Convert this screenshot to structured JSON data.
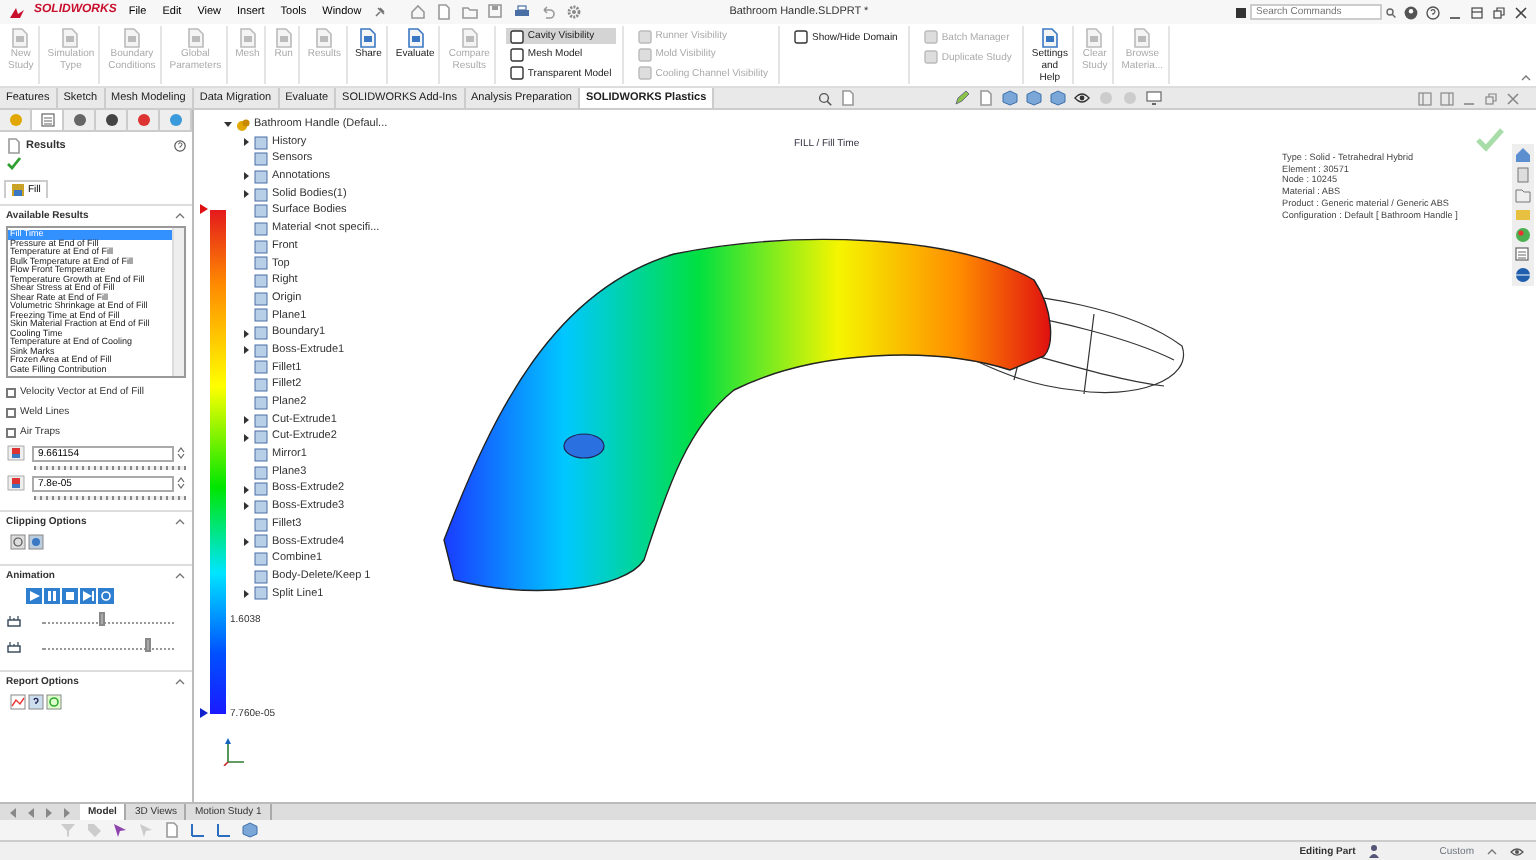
{
  "title_bar": {
    "logo": "SOLIDWORKS",
    "menus": [
      "File",
      "Edit",
      "View",
      "Insert",
      "Tools",
      "Window"
    ],
    "document_title": "Bathroom Handle.SLDPRT *",
    "search": {
      "placeholder": "Search Commands"
    }
  },
  "ribbon": [
    {
      "kind": "large",
      "label": "New Study",
      "disabled": true
    },
    {
      "kind": "large",
      "label": "Simulation Type",
      "disabled": true
    },
    {
      "kind": "large",
      "label": "Boundary Conditions",
      "disabled": true
    },
    {
      "kind": "large",
      "label": "Global Parameters",
      "disabled": true
    },
    {
      "kind": "large",
      "label": "Mesh",
      "disabled": true
    },
    {
      "kind": "large",
      "label": "Run",
      "disabled": true
    },
    {
      "kind": "large",
      "label": "Results",
      "disabled": true
    },
    {
      "kind": "large",
      "label": "Share",
      "disabled": false
    },
    {
      "kind": "large",
      "label": "Evaluate",
      "disabled": false
    },
    {
      "kind": "large",
      "label": "Compare Results",
      "disabled": true
    },
    {
      "kind": "stack",
      "buttons": [
        {
          "label": "Cavity Visibility",
          "disabled": false,
          "selected": true
        },
        {
          "label": "Mesh Model",
          "disabled": false,
          "selected": false
        },
        {
          "label": "Transparent Model",
          "disabled": false,
          "selected": false
        }
      ]
    },
    {
      "kind": "stack",
      "buttons": [
        {
          "label": "Runner Visibility",
          "disabled": true,
          "selected": false
        },
        {
          "label": "Mold Visibility",
          "disabled": true,
          "selected": false
        },
        {
          "label": "Cooling Channel Visibility",
          "disabled": true,
          "selected": false
        }
      ]
    },
    {
      "kind": "stack",
      "buttons": [
        {
          "label": "Show/Hide Domain",
          "disabled": false,
          "selected": false
        }
      ]
    },
    {
      "kind": "stack",
      "buttons": [
        {
          "label": "Batch Manager",
          "disabled": true,
          "selected": false
        },
        {
          "label": "Duplicate Study",
          "disabled": true,
          "selected": false
        }
      ]
    },
    {
      "kind": "large",
      "label": "Settings and Help",
      "disabled": false
    },
    {
      "kind": "large",
      "label": "Clear Study",
      "disabled": true
    },
    {
      "kind": "large",
      "label": "Browse Materia...",
      "disabled": true
    }
  ],
  "command_tabs": [
    {
      "label": "Features",
      "selected": false
    },
    {
      "label": "Sketch",
      "selected": false
    },
    {
      "label": "Mesh Modeling",
      "selected": false
    },
    {
      "label": "Data Migration",
      "selected": false
    },
    {
      "label": "Evaluate",
      "selected": false
    },
    {
      "label": "SOLIDWORKS Add-Ins",
      "selected": false
    },
    {
      "label": "Analysis Preparation",
      "selected": false
    },
    {
      "label": "SOLIDWORKS Plastics",
      "selected": true
    }
  ],
  "property_manager": {
    "tabs": [
      {
        "selected": false
      },
      {
        "selected": true
      },
      {
        "selected": false
      },
      {
        "selected": false
      },
      {
        "selected": false
      },
      {
        "selected": false
      }
    ],
    "title": "Results",
    "result_tabs": [
      {
        "label": "Fill",
        "selected": true
      }
    ],
    "available_results": {
      "title": "Available Results",
      "items": [
        {
          "label": "Fill Time",
          "selected": true
        },
        {
          "label": "Pressure at End of Fill",
          "selected": false
        },
        {
          "label": "Temperature at End of Fill",
          "selected": false
        },
        {
          "label": "Bulk Temperature at End of Fill",
          "selected": false
        },
        {
          "label": "Flow Front Temperature",
          "selected": false
        },
        {
          "label": "Temperature Growth at End of Fill",
          "selected": false
        },
        {
          "label": "Shear Stress at End of Fill",
          "selected": false
        },
        {
          "label": "Shear Rate at End of Fill",
          "selected": false
        },
        {
          "label": "Volumetric Shrinkage at End of Fill",
          "selected": false
        },
        {
          "label": "Freezing Time at End of Fill",
          "selected": false
        },
        {
          "label": "Skin Material Fraction at End of Fill",
          "selected": false
        },
        {
          "label": "Cooling Time",
          "selected": false
        },
        {
          "label": "Temperature at End of Cooling",
          "selected": false
        },
        {
          "label": "Sink Marks",
          "selected": false
        },
        {
          "label": "Frozen Area at End of Fill",
          "selected": false
        },
        {
          "label": "Gate Filling Contribution",
          "selected": false
        }
      ]
    },
    "options": [
      {
        "label": "Velocity Vector at End of Fill",
        "checked": false
      },
      {
        "label": "Weld Lines",
        "checked": false
      },
      {
        "label": "Air Traps",
        "checked": false
      }
    ],
    "fields": [
      {
        "value": "9.661154"
      },
      {
        "value": "7.8e-05"
      }
    ],
    "clipping": {
      "title": "Clipping Options"
    },
    "animation": {
      "title": "Animation",
      "sliders": [
        {
          "level": 0.45
        },
        {
          "level": 0.8
        }
      ]
    },
    "report": {
      "title": "Report Options"
    }
  },
  "feature_tree": {
    "root": {
      "label": "Bathroom Handle (Defaul...",
      "expanded": true
    },
    "items": [
      {
        "label": "History",
        "expandable": true
      },
      {
        "label": "Sensors",
        "expandable": false
      },
      {
        "label": "Annotations",
        "expandable": true
      },
      {
        "label": "Solid Bodies(1)",
        "expandable": true
      },
      {
        "label": "Surface Bodies",
        "expandable": false
      },
      {
        "label": "Material <not specifi...",
        "expandable": false
      },
      {
        "label": "Front",
        "expandable": false
      },
      {
        "label": "Top",
        "expandable": false
      },
      {
        "label": "Right",
        "expandable": false
      },
      {
        "label": "Origin",
        "expandable": false
      },
      {
        "label": "Plane1",
        "expandable": false
      },
      {
        "label": "Boundary1",
        "expandable": true
      },
      {
        "label": "Boss-Extrude1",
        "expandable": true
      },
      {
        "label": "Fillet1",
        "expandable": false
      },
      {
        "label": "Fillet2",
        "expandable": false
      },
      {
        "label": "Plane2",
        "expandable": false
      },
      {
        "label": "Cut-Extrude1",
        "expandable": true
      },
      {
        "label": "Cut-Extrude2",
        "expandable": true
      },
      {
        "label": "Mirror1",
        "expandable": false
      },
      {
        "label": "Plane3",
        "expandable": false
      },
      {
        "label": "Boss-Extrude2",
        "expandable": true
      },
      {
        "label": "Boss-Extrude3",
        "expandable": true
      },
      {
        "label": "Fillet3",
        "expandable": false
      },
      {
        "label": "Boss-Extrude4",
        "expandable": true
      },
      {
        "label": "Combine1",
        "expandable": false
      },
      {
        "label": "Body-Delete/Keep 1",
        "expandable": false
      },
      {
        "label": "Split Line1",
        "expandable": true
      }
    ]
  },
  "viewport": {
    "plot_title": "FILL / Fill Time",
    "info": [
      "Type : Solid - Tetrahedral Hybrid",
      "Element : 30571",
      "Node : 10245",
      "Material : ABS",
      "Product : Generic material / Generic ABS",
      "Configuration : Default [ Bathroom Handle ]"
    ],
    "legend_labels": [
      "1.6038",
      "7.760e-05"
    ]
  },
  "bottom_tabs": [
    {
      "label": "Model",
      "selected": true
    },
    {
      "label": "3D Views",
      "selected": false
    },
    {
      "label": "Motion Study 1",
      "selected": false
    }
  ],
  "status_bar": {
    "mode": "Editing Part",
    "units": "Custom"
  }
}
